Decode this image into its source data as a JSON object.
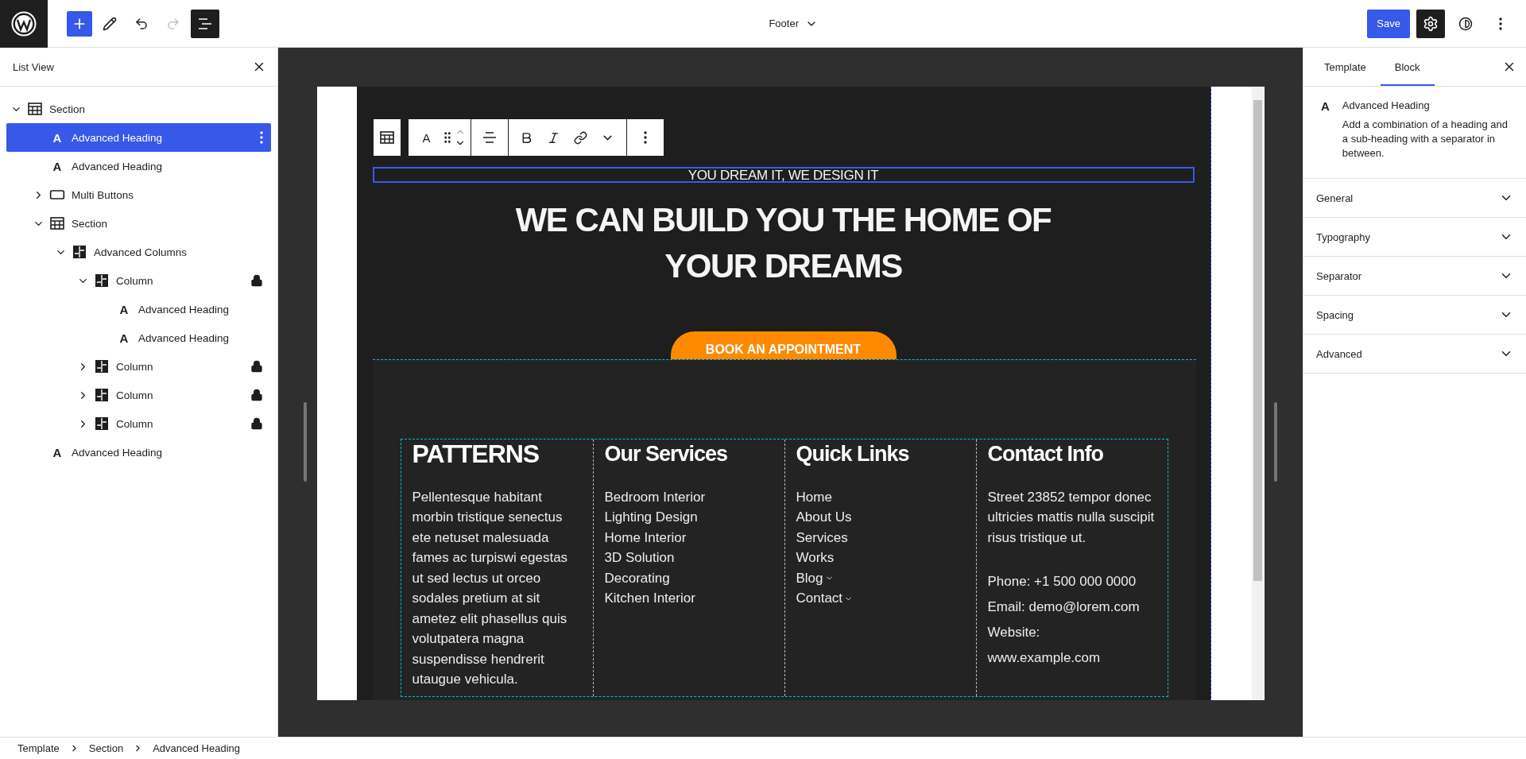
{
  "topbar": {
    "tools": [
      {
        "kind": "add",
        "pressed": false,
        "disabled": false
      },
      {
        "kind": "edit",
        "pressed": false,
        "disabled": false
      },
      {
        "kind": "undo",
        "pressed": false,
        "disabled": false
      },
      {
        "kind": "redo",
        "pressed": false,
        "disabled": true
      },
      {
        "kind": "list",
        "pressed": true,
        "disabled": false
      }
    ],
    "document_title": "Footer",
    "save": "Save",
    "actions": [
      {
        "kind": "settings",
        "pressed": true
      },
      {
        "kind": "styles",
        "pressed": false
      },
      {
        "kind": "options",
        "pressed": false
      }
    ]
  },
  "list_view": {
    "title": "List View",
    "items": [
      {
        "label": "Section",
        "kind": "section",
        "expanded": true,
        "selected": false,
        "children": [
          {
            "label": "Advanced Heading",
            "kind": "heading",
            "glyph": "A",
            "selected": true
          },
          {
            "label": "Advanced Heading",
            "kind": "heading",
            "glyph": "A",
            "selected": false
          },
          {
            "label": "Multi Buttons",
            "kind": "buttons",
            "expanded": false,
            "selected": false
          },
          {
            "label": "Section",
            "kind": "section",
            "expanded": true,
            "selected": false,
            "children": [
              {
                "label": "Advanced Columns",
                "kind": "columns",
                "expanded": true,
                "selected": false,
                "children": [
                  {
                    "label": "Column",
                    "kind": "column",
                    "expanded": true,
                    "locked": true,
                    "selected": false,
                    "children": [
                      {
                        "label": "Advanced Heading",
                        "kind": "heading",
                        "glyph": "A",
                        "selected": false
                      },
                      {
                        "label": "Advanced Heading",
                        "kind": "heading",
                        "glyph": "A",
                        "selected": false
                      }
                    ]
                  },
                  {
                    "label": "Column",
                    "kind": "column",
                    "expanded": false,
                    "locked": true,
                    "selected": false
                  },
                  {
                    "label": "Column",
                    "kind": "column",
                    "expanded": false,
                    "locked": true,
                    "selected": false
                  },
                  {
                    "label": "Column",
                    "kind": "column",
                    "expanded": false,
                    "locked": true,
                    "selected": false
                  }
                ]
              }
            ]
          },
          {
            "label": "Advanced Heading",
            "kind": "heading",
            "glyph": "A",
            "selected": false
          }
        ]
      }
    ]
  },
  "canvas": {
    "block_toolbar_glyph": "A",
    "subheading": "YOU DREAM IT, WE DESIGN IT",
    "heading": "WE CAN BUILD YOU THE HOME OF YOUR DREAMS",
    "button": "BOOK AN APPOINTMENT",
    "footer_columns": [
      {
        "kind": "text",
        "heading": "PATTERNS",
        "text": "Pellentesque habitant morbin tristique senectus ete netuset malesuada fames ac turpiswi egestas ut sed lectus ut orceo sodales pretium at sit ametez elit phasellus quis volutpatera magna suspendisse hendrerit utaugue vehicula."
      },
      {
        "kind": "links",
        "heading": "Our Services",
        "links": [
          {
            "label": "Bedroom Interior",
            "submenu": false
          },
          {
            "label": "Lighting Design",
            "submenu": false
          },
          {
            "label": "Home Interior",
            "submenu": false
          },
          {
            "label": "3D Solution",
            "submenu": false
          },
          {
            "label": "Decorating",
            "submenu": false
          },
          {
            "label": "Kitchen Interior",
            "submenu": false
          }
        ]
      },
      {
        "kind": "links",
        "heading": "Quick Links",
        "links": [
          {
            "label": "Home",
            "submenu": false
          },
          {
            "label": "About Us",
            "submenu": false
          },
          {
            "label": "Services",
            "submenu": false
          },
          {
            "label": "Works",
            "submenu": false
          },
          {
            "label": "Blog",
            "submenu": true
          },
          {
            "label": "Contact",
            "submenu": true
          }
        ]
      },
      {
        "kind": "contact",
        "heading": "Contact Info",
        "text": "Street 23852 tempor donec ultricies mattis nulla suscipit risus tristique ut.",
        "lines": [
          "Phone: +1 500 000 0000",
          "Email: demo@lorem.com",
          "Website:",
          "www.example.com"
        ]
      }
    ]
  },
  "sidebar": {
    "tabs": [
      {
        "label": "Template",
        "selected": false
      },
      {
        "label": "Block",
        "selected": true
      }
    ],
    "block": {
      "glyph": "A",
      "title": "Advanced Heading",
      "description": "Add a combination of a heading and a sub-heading with a separator in between."
    },
    "panels": [
      {
        "label": "General",
        "expanded": false
      },
      {
        "label": "Typography",
        "expanded": false
      },
      {
        "label": "Separator",
        "expanded": false
      },
      {
        "label": "Spacing",
        "expanded": false
      },
      {
        "label": "Advanced",
        "expanded": false
      }
    ]
  },
  "breadcrumbs": [
    "Template",
    "Section",
    "Advanced Heading"
  ]
}
